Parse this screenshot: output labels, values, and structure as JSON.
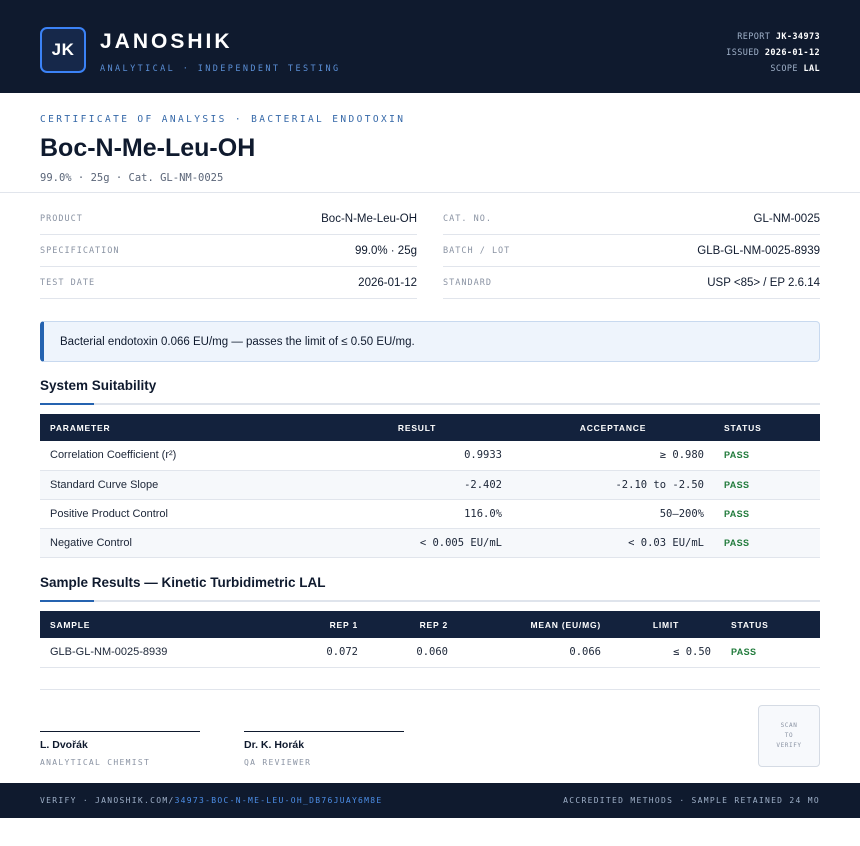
{
  "brand": {
    "logo": "JK",
    "name": "JANOSHIK",
    "tagline": "ANALYTICAL · INDEPENDENT TESTING"
  },
  "report_meta": {
    "report_label": "REPORT",
    "report_value": "JK-34973",
    "issued_label": "ISSUED",
    "issued_value": "2026-01-12",
    "scope_label": "SCOPE",
    "scope_value": "LAL"
  },
  "certificate": {
    "kicker": "CERTIFICATE OF ANALYSIS · BACTERIAL ENDOTOXIN",
    "title": "Boc-N-Me-Leu-OH",
    "subtitle": "99.0% · 25g  ·  Cat. GL-NM-0025"
  },
  "info_left": [
    {
      "label": "PRODUCT",
      "value": "Boc-N-Me-Leu-OH"
    },
    {
      "label": "SPECIFICATION",
      "value": "99.0% · 25g"
    },
    {
      "label": "TEST DATE",
      "value": "2026-01-12"
    }
  ],
  "info_right": [
    {
      "label": "CAT. NO.",
      "value": "GL-NM-0025"
    },
    {
      "label": "BATCH / LOT",
      "value": "GLB-GL-NM-0025-8939"
    },
    {
      "label": "STANDARD",
      "value": "USP <85> / EP 2.6.14"
    }
  ],
  "callout": "Bacterial endotoxin 0.066 EU/mg — passes the limit of ≤ 0.50 EU/mg.",
  "system_suitability": {
    "title": "System Suitability",
    "headers": [
      "PARAMETER",
      "RESULT",
      "ACCEPTANCE",
      "STATUS"
    ],
    "rows": [
      {
        "parameter": "Correlation Coefficient (r²)",
        "result": "0.9933",
        "acceptance": "≥ 0.980",
        "status": "PASS"
      },
      {
        "parameter": "Standard Curve Slope",
        "result": "-2.402",
        "acceptance": "-2.10 to -2.50",
        "status": "PASS"
      },
      {
        "parameter": "Positive Product Control",
        "result": "116.0%",
        "acceptance": "50–200%",
        "status": "PASS"
      },
      {
        "parameter": "Negative Control",
        "result": "< 0.005 EU/mL",
        "acceptance": "< 0.03 EU/mL",
        "status": "PASS"
      }
    ]
  },
  "sample_results": {
    "title": "Sample Results — Kinetic Turbidimetric LAL",
    "headers": [
      "SAMPLE",
      "REP 1",
      "REP 2",
      "MEAN (EU/MG)",
      "LIMIT",
      "STATUS"
    ],
    "rows": [
      {
        "sample": "GLB-GL-NM-0025-8939",
        "rep1": "0.072",
        "rep2": "0.060",
        "mean": "0.066",
        "limit": "≤ 0.50",
        "status": "PASS"
      }
    ]
  },
  "signatures": [
    {
      "name": "L. Dvořák",
      "role": "ANALYTICAL CHEMIST"
    },
    {
      "name": "Dr. K. Horák",
      "role": "QA REVIEWER"
    }
  ],
  "qr": {
    "line1": "SCAN",
    "line2": "TO",
    "line3": "VERIFY"
  },
  "footer": {
    "verify_prefix": "VERIFY · JANOSHIK.COM/",
    "verify_link": "34973-BOC-N-ME-LEU-OH_DB76JUAY6M8E",
    "right": "ACCREDITED METHODS · SAMPLE RETAINED 24 MO"
  },
  "colors": {
    "navy": "#0f1a2e",
    "accent_blue": "#2563b0",
    "pass_green": "#1f7a3a"
  }
}
